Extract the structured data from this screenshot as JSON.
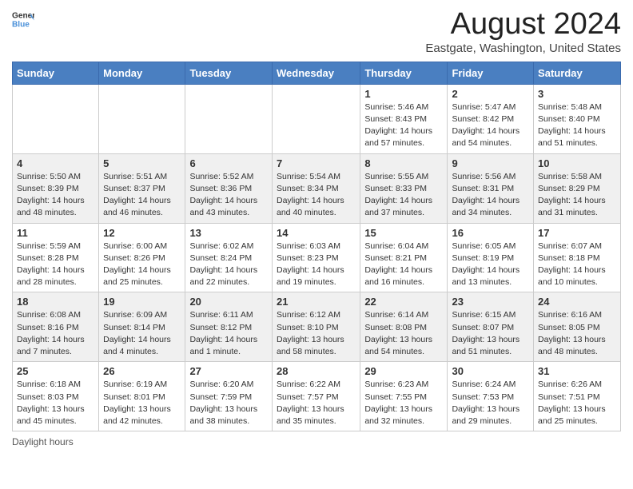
{
  "logo": {
    "general": "General",
    "blue": "Blue"
  },
  "title": "August 2024",
  "subtitle": "Eastgate, Washington, United States",
  "days_of_week": [
    "Sunday",
    "Monday",
    "Tuesday",
    "Wednesday",
    "Thursday",
    "Friday",
    "Saturday"
  ],
  "footer": "Daylight hours",
  "weeks": [
    [
      {
        "num": "",
        "info": ""
      },
      {
        "num": "",
        "info": ""
      },
      {
        "num": "",
        "info": ""
      },
      {
        "num": "",
        "info": ""
      },
      {
        "num": "1",
        "info": "Sunrise: 5:46 AM\nSunset: 8:43 PM\nDaylight: 14 hours and 57 minutes."
      },
      {
        "num": "2",
        "info": "Sunrise: 5:47 AM\nSunset: 8:42 PM\nDaylight: 14 hours and 54 minutes."
      },
      {
        "num": "3",
        "info": "Sunrise: 5:48 AM\nSunset: 8:40 PM\nDaylight: 14 hours and 51 minutes."
      }
    ],
    [
      {
        "num": "4",
        "info": "Sunrise: 5:50 AM\nSunset: 8:39 PM\nDaylight: 14 hours and 48 minutes."
      },
      {
        "num": "5",
        "info": "Sunrise: 5:51 AM\nSunset: 8:37 PM\nDaylight: 14 hours and 46 minutes."
      },
      {
        "num": "6",
        "info": "Sunrise: 5:52 AM\nSunset: 8:36 PM\nDaylight: 14 hours and 43 minutes."
      },
      {
        "num": "7",
        "info": "Sunrise: 5:54 AM\nSunset: 8:34 PM\nDaylight: 14 hours and 40 minutes."
      },
      {
        "num": "8",
        "info": "Sunrise: 5:55 AM\nSunset: 8:33 PM\nDaylight: 14 hours and 37 minutes."
      },
      {
        "num": "9",
        "info": "Sunrise: 5:56 AM\nSunset: 8:31 PM\nDaylight: 14 hours and 34 minutes."
      },
      {
        "num": "10",
        "info": "Sunrise: 5:58 AM\nSunset: 8:29 PM\nDaylight: 14 hours and 31 minutes."
      }
    ],
    [
      {
        "num": "11",
        "info": "Sunrise: 5:59 AM\nSunset: 8:28 PM\nDaylight: 14 hours and 28 minutes."
      },
      {
        "num": "12",
        "info": "Sunrise: 6:00 AM\nSunset: 8:26 PM\nDaylight: 14 hours and 25 minutes."
      },
      {
        "num": "13",
        "info": "Sunrise: 6:02 AM\nSunset: 8:24 PM\nDaylight: 14 hours and 22 minutes."
      },
      {
        "num": "14",
        "info": "Sunrise: 6:03 AM\nSunset: 8:23 PM\nDaylight: 14 hours and 19 minutes."
      },
      {
        "num": "15",
        "info": "Sunrise: 6:04 AM\nSunset: 8:21 PM\nDaylight: 14 hours and 16 minutes."
      },
      {
        "num": "16",
        "info": "Sunrise: 6:05 AM\nSunset: 8:19 PM\nDaylight: 14 hours and 13 minutes."
      },
      {
        "num": "17",
        "info": "Sunrise: 6:07 AM\nSunset: 8:18 PM\nDaylight: 14 hours and 10 minutes."
      }
    ],
    [
      {
        "num": "18",
        "info": "Sunrise: 6:08 AM\nSunset: 8:16 PM\nDaylight: 14 hours and 7 minutes."
      },
      {
        "num": "19",
        "info": "Sunrise: 6:09 AM\nSunset: 8:14 PM\nDaylight: 14 hours and 4 minutes."
      },
      {
        "num": "20",
        "info": "Sunrise: 6:11 AM\nSunset: 8:12 PM\nDaylight: 14 hours and 1 minute."
      },
      {
        "num": "21",
        "info": "Sunrise: 6:12 AM\nSunset: 8:10 PM\nDaylight: 13 hours and 58 minutes."
      },
      {
        "num": "22",
        "info": "Sunrise: 6:14 AM\nSunset: 8:08 PM\nDaylight: 13 hours and 54 minutes."
      },
      {
        "num": "23",
        "info": "Sunrise: 6:15 AM\nSunset: 8:07 PM\nDaylight: 13 hours and 51 minutes."
      },
      {
        "num": "24",
        "info": "Sunrise: 6:16 AM\nSunset: 8:05 PM\nDaylight: 13 hours and 48 minutes."
      }
    ],
    [
      {
        "num": "25",
        "info": "Sunrise: 6:18 AM\nSunset: 8:03 PM\nDaylight: 13 hours and 45 minutes."
      },
      {
        "num": "26",
        "info": "Sunrise: 6:19 AM\nSunset: 8:01 PM\nDaylight: 13 hours and 42 minutes."
      },
      {
        "num": "27",
        "info": "Sunrise: 6:20 AM\nSunset: 7:59 PM\nDaylight: 13 hours and 38 minutes."
      },
      {
        "num": "28",
        "info": "Sunrise: 6:22 AM\nSunset: 7:57 PM\nDaylight: 13 hours and 35 minutes."
      },
      {
        "num": "29",
        "info": "Sunrise: 6:23 AM\nSunset: 7:55 PM\nDaylight: 13 hours and 32 minutes."
      },
      {
        "num": "30",
        "info": "Sunrise: 6:24 AM\nSunset: 7:53 PM\nDaylight: 13 hours and 29 minutes."
      },
      {
        "num": "31",
        "info": "Sunrise: 6:26 AM\nSunset: 7:51 PM\nDaylight: 13 hours and 25 minutes."
      }
    ]
  ]
}
